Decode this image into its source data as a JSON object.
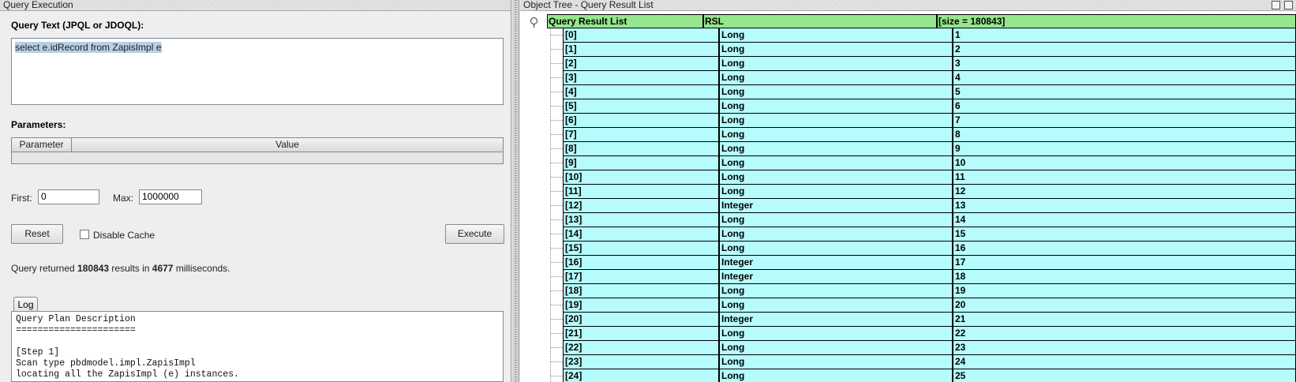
{
  "left_panel": {
    "title": "Query Execution",
    "query_text_label": "Query Text (JPQL or JDOQL):",
    "query_text_value": "select e.idRecord from ZapisImpl e",
    "parameters_label": "Parameters:",
    "param_col_parameter": "Parameter",
    "param_col_value": "Value",
    "first_label": "First:",
    "first_value": "0",
    "max_label": "Max:",
    "max_value": "1000000",
    "reset_label": "Reset",
    "disable_cache_label": "Disable Cache",
    "execute_label": "Execute",
    "status_prefix": "Query returned ",
    "status_count": "180843",
    "status_middle": " results in ",
    "status_ms": "4677",
    "status_suffix": " milliseconds.",
    "log_tab_label": "Log",
    "log_text": "Query Plan Description\n======================\n\n[Step 1]\nScan type pbdmodel.impl.ZapisImpl\nlocating all the ZapisImpl (e) instances."
  },
  "right_panel": {
    "title": "Object Tree - Query Result List",
    "header": {
      "name": "Query Result List",
      "type": "RSL",
      "value": "[size = 180843]"
    },
    "rows": [
      {
        "index": "[0]",
        "type": "Long",
        "value": "1"
      },
      {
        "index": "[1]",
        "type": "Long",
        "value": "2"
      },
      {
        "index": "[2]",
        "type": "Long",
        "value": "3"
      },
      {
        "index": "[3]",
        "type": "Long",
        "value": "4"
      },
      {
        "index": "[4]",
        "type": "Long",
        "value": "5"
      },
      {
        "index": "[5]",
        "type": "Long",
        "value": "6"
      },
      {
        "index": "[6]",
        "type": "Long",
        "value": "7"
      },
      {
        "index": "[7]",
        "type": "Long",
        "value": "8"
      },
      {
        "index": "[8]",
        "type": "Long",
        "value": "9"
      },
      {
        "index": "[9]",
        "type": "Long",
        "value": "10"
      },
      {
        "index": "[10]",
        "type": "Long",
        "value": "11"
      },
      {
        "index": "[11]",
        "type": "Long",
        "value": "12"
      },
      {
        "index": "[12]",
        "type": "Integer",
        "value": "13"
      },
      {
        "index": "[13]",
        "type": "Long",
        "value": "14"
      },
      {
        "index": "[14]",
        "type": "Long",
        "value": "15"
      },
      {
        "index": "[15]",
        "type": "Long",
        "value": "16"
      },
      {
        "index": "[16]",
        "type": "Integer",
        "value": "17"
      },
      {
        "index": "[17]",
        "type": "Integer",
        "value": "18"
      },
      {
        "index": "[18]",
        "type": "Long",
        "value": "19"
      },
      {
        "index": "[19]",
        "type": "Long",
        "value": "20"
      },
      {
        "index": "[20]",
        "type": "Integer",
        "value": "21"
      },
      {
        "index": "[21]",
        "type": "Long",
        "value": "22"
      },
      {
        "index": "[22]",
        "type": "Long",
        "value": "23"
      },
      {
        "index": "[23]",
        "type": "Long",
        "value": "24"
      },
      {
        "index": "[24]",
        "type": "Long",
        "value": "25"
      }
    ]
  },
  "colors": {
    "header_green": "#95e68c",
    "row_cyan": "#b6fcfc",
    "selection": "#b8cfe5"
  }
}
